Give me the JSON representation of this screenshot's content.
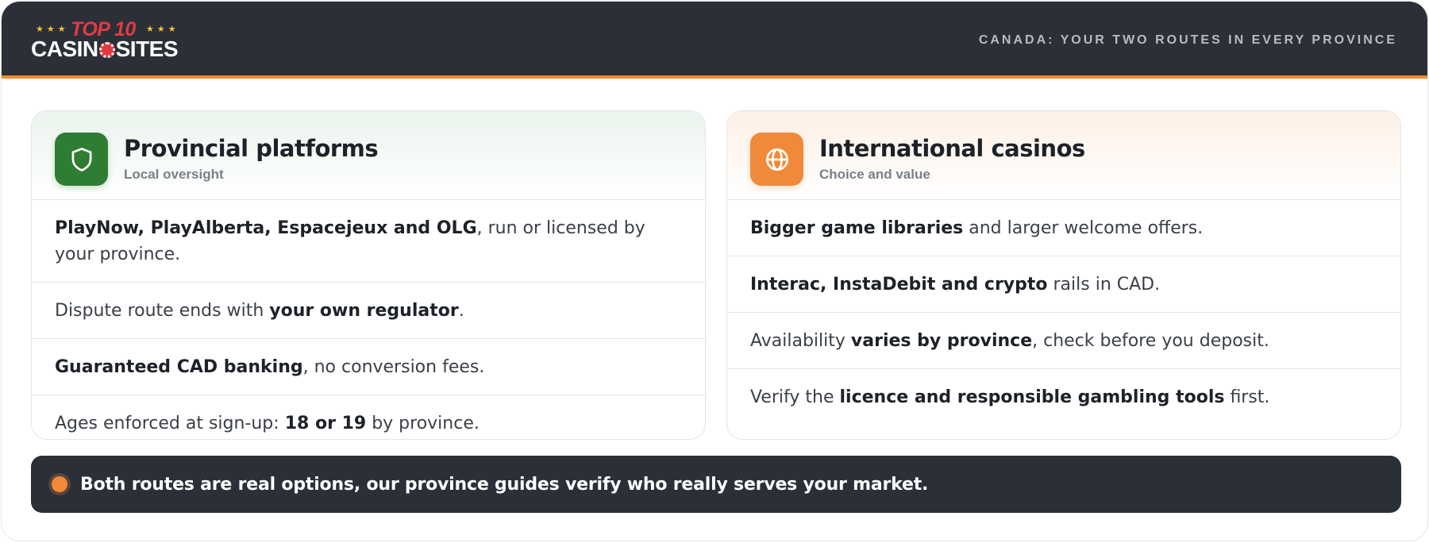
{
  "header": {
    "logo": {
      "stars": "★★★",
      "top_text": "TOP 10",
      "brand_left": "CASIN",
      "brand_right": "SITES"
    },
    "tagline": "CANADA: YOUR TWO ROUTES IN EVERY PROVINCE"
  },
  "colors": {
    "header_bg": "#2a2f38",
    "accent_orange": "#f08a3a",
    "provincial_green": "#2e7d32",
    "logo_red": "#e23a44"
  },
  "cards": [
    {
      "icon": "shield-icon",
      "title": "Provincial platforms",
      "subtitle": "Local oversight",
      "rows": [
        {
          "parts": [
            {
              "text": "PlayNow, PlayAlberta, Espacejeux and OLG",
              "bold": true
            },
            {
              "text": ", run or licensed by your province.",
              "bold": false
            }
          ]
        },
        {
          "parts": [
            {
              "text": "Dispute route ends with ",
              "bold": false
            },
            {
              "text": "your own regulator",
              "bold": true
            },
            {
              "text": ".",
              "bold": false
            }
          ]
        },
        {
          "parts": [
            {
              "text": "Guaranteed CAD banking",
              "bold": true
            },
            {
              "text": ", no conversion fees.",
              "bold": false
            }
          ]
        },
        {
          "parts": [
            {
              "text": "Ages enforced at sign-up: ",
              "bold": false
            },
            {
              "text": "18 or 19",
              "bold": true
            },
            {
              "text": " by province.",
              "bold": false
            }
          ]
        }
      ]
    },
    {
      "icon": "globe-icon",
      "title": "International casinos",
      "subtitle": "Choice and value",
      "rows": [
        {
          "parts": [
            {
              "text": "Bigger game libraries",
              "bold": true
            },
            {
              "text": " and larger welcome offers.",
              "bold": false
            }
          ]
        },
        {
          "parts": [
            {
              "text": "Interac, InstaDebit and crypto",
              "bold": true
            },
            {
              "text": " rails in CAD.",
              "bold": false
            }
          ]
        },
        {
          "parts": [
            {
              "text": "Availability ",
              "bold": false
            },
            {
              "text": "varies by province",
              "bold": true
            },
            {
              "text": ", check before you deposit.",
              "bold": false
            }
          ]
        },
        {
          "parts": [
            {
              "text": "Verify the ",
              "bold": false
            },
            {
              "text": "licence and responsible gambling tools",
              "bold": true
            },
            {
              "text": " first.",
              "bold": false
            }
          ]
        }
      ]
    }
  ],
  "banner": {
    "text": "Both routes are real options, our province guides verify who really serves your market."
  }
}
